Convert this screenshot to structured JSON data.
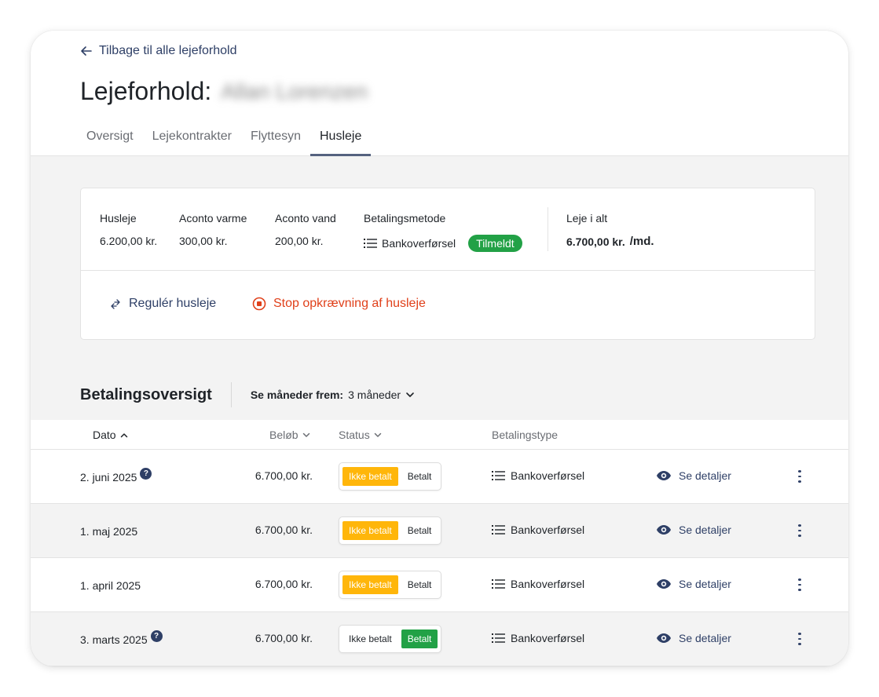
{
  "header": {
    "back_label": "Tilbage til alle lejeforhold",
    "title": "Lejeforhold:",
    "tenant_name": "Allan Lorenzen",
    "tabs": [
      {
        "label": "Oversigt",
        "active": false
      },
      {
        "label": "Lejekontrakter",
        "active": false
      },
      {
        "label": "Flyttesyn",
        "active": false
      },
      {
        "label": "Husleje",
        "active": true
      }
    ]
  },
  "summary": {
    "rent_label": "Husleje",
    "rent_value": "6.200,00 kr.",
    "heat_label": "Aconto varme",
    "heat_value": "300,00 kr.",
    "water_label": "Aconto vand",
    "water_value": "200,00 kr.",
    "method_label": "Betalingsmetode",
    "method_value": "Bankoverførsel",
    "method_status": "Tilmeldt",
    "total_label": "Leje i alt",
    "total_value": "6.700,00 kr.",
    "total_unit": "/md.",
    "regulate_label": "Regulér husleje",
    "stop_label": "Stop opkrævning af husleje"
  },
  "payments": {
    "title": "Betalingsoversigt",
    "months_label": "Se måneder frem:",
    "months_value": "3 måneder",
    "columns": {
      "date": "Dato",
      "amount": "Beløb",
      "status": "Status",
      "type": "Betalingstype"
    },
    "unpaid_label": "Ikke betalt",
    "paid_label": "Betalt",
    "details_label": "Se detaljer",
    "rows": [
      {
        "date": "2. juni 2025",
        "amount": "6.700,00 kr.",
        "status": "unpaid",
        "type": "Bankoverførsel",
        "help": true
      },
      {
        "date": "1. maj 2025",
        "amount": "6.700,00 kr.",
        "status": "unpaid",
        "type": "Bankoverførsel",
        "help": false
      },
      {
        "date": "1. april 2025",
        "amount": "6.700,00 kr.",
        "status": "unpaid",
        "type": "Bankoverførsel",
        "help": false
      },
      {
        "date": "3. marts 2025",
        "amount": "6.700,00 kr.",
        "status": "paid",
        "type": "Bankoverførsel",
        "help": true
      }
    ]
  },
  "colors": {
    "accent": "#2e3f66",
    "paid": "#22a146",
    "unpaid": "#ffb60a",
    "danger": "#e0401a"
  }
}
